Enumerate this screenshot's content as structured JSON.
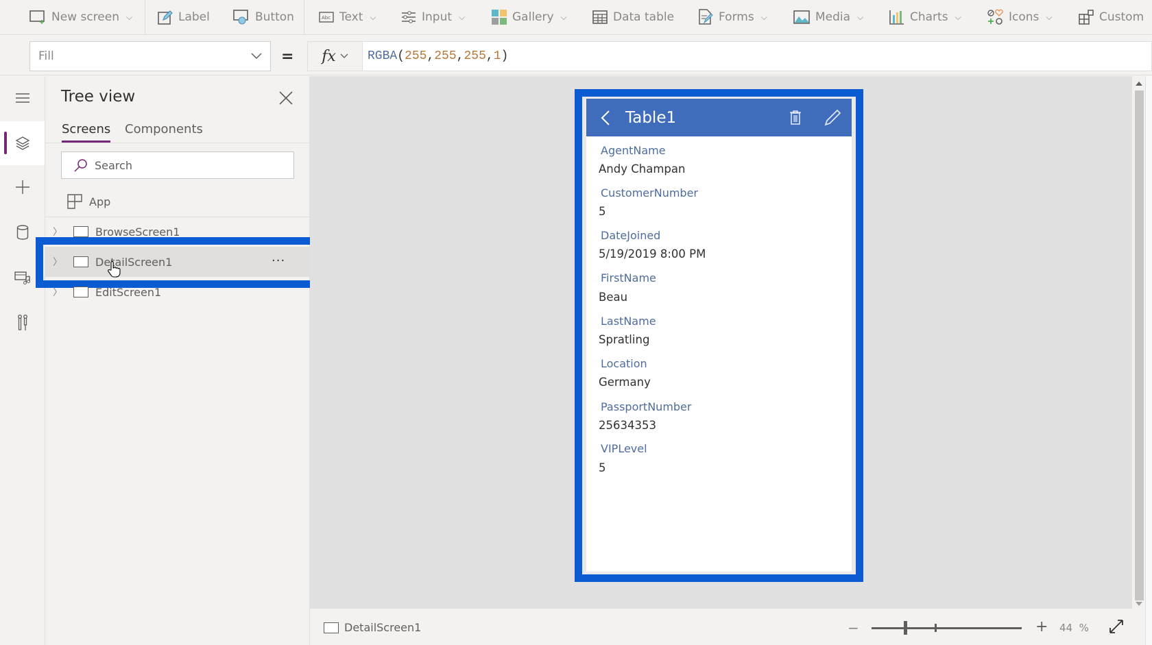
{
  "toolbar": {
    "items": [
      {
        "label": "New screen",
        "icon": "new-screen-icon",
        "dropdown": true
      },
      {
        "label": "Label",
        "icon": "label-icon",
        "dropdown": false
      },
      {
        "label": "Button",
        "icon": "button-icon",
        "dropdown": false
      },
      {
        "label": "Text",
        "icon": "text-icon",
        "dropdown": true
      },
      {
        "label": "Input",
        "icon": "input-icon",
        "dropdown": true
      },
      {
        "label": "Gallery",
        "icon": "gallery-icon",
        "dropdown": true
      },
      {
        "label": "Data table",
        "icon": "data-table-icon",
        "dropdown": false
      },
      {
        "label": "Forms",
        "icon": "forms-icon",
        "dropdown": true
      },
      {
        "label": "Media",
        "icon": "media-icon",
        "dropdown": true
      },
      {
        "label": "Charts",
        "icon": "charts-icon",
        "dropdown": true
      },
      {
        "label": "Icons",
        "icon": "icons-icon",
        "dropdown": true
      },
      {
        "label": "Custom",
        "icon": "custom-icon",
        "dropdown": true
      }
    ]
  },
  "formula_bar": {
    "property": "Fill",
    "equals": "=",
    "fx": "fx",
    "formula": {
      "fn": "RGBA",
      "open": "(",
      "args": [
        "255",
        "255",
        "255",
        "1"
      ],
      "sep": ", ",
      "close": ")"
    }
  },
  "rail": {
    "items": [
      "menu-icon",
      "tree-view-icon",
      "insert-icon",
      "data-icon",
      "media-icon",
      "tools-icon"
    ],
    "active": "tree-view-icon"
  },
  "tree_view": {
    "title": "Tree view",
    "tabs": [
      {
        "label": "Screens",
        "active": true
      },
      {
        "label": "Components",
        "active": false
      }
    ],
    "search_placeholder": "Search",
    "app_label": "App",
    "screens": [
      {
        "label": "BrowseScreen1",
        "selected": false
      },
      {
        "label": "DetailScreen1",
        "selected": true
      },
      {
        "label": "EditScreen1",
        "selected": false
      }
    ],
    "more": "···"
  },
  "phone": {
    "title": "Table1",
    "fields": [
      {
        "label": "AgentName",
        "value": "Andy Champan"
      },
      {
        "label": "CustomerNumber",
        "value": "5"
      },
      {
        "label": "DateJoined",
        "value": "5/19/2019 8:00 PM"
      },
      {
        "label": "FirstName",
        "value": "Beau"
      },
      {
        "label": "LastName",
        "value": "Spratling"
      },
      {
        "label": "Location",
        "value": "Germany"
      },
      {
        "label": "PassportNumber",
        "value": "25634353"
      },
      {
        "label": "VIPLevel",
        "value": "5"
      }
    ]
  },
  "status_bar": {
    "screen_name": "DetailScreen1",
    "zoom_minus": "−",
    "zoom_plus": "+",
    "zoom_value": "44",
    "zoom_unit": "%",
    "zoom_percent": 44
  },
  "colors": {
    "accent_purple": "#742774",
    "highlight_blue": "#0b5bd3",
    "header_blue": "#3f6dbb"
  }
}
